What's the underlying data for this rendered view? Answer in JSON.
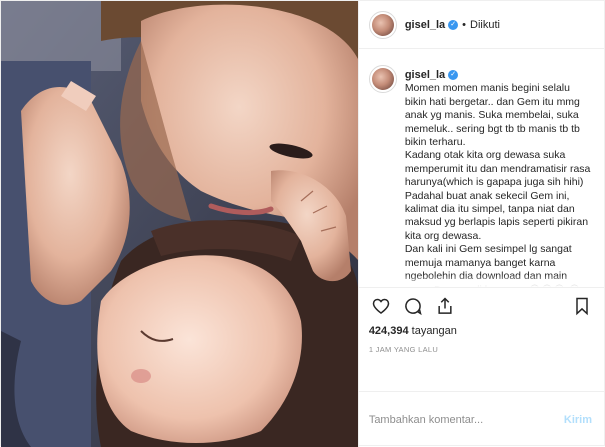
{
  "post": {
    "username": "gisel_la",
    "verified": true,
    "follow_separator": "•",
    "follow_state": "Diikuti",
    "caption_user": "gisel_la",
    "caption_text": "Momen momen manis begini selalu bikin hati bergetar.. dan Gem itu mmg anak yg manis. Suka membelai, suka memeluk.. sering bgt tb tb manis tb tb bikin terharu.\nKadang otak kita org dewasa suka memperumit itu dan mendramatisir rasa harunya(which is gapapa juga sih hihi)\nPadahal buat anak sekecil Gem ini, kalimat dia itu simpel, tanpa niat dan maksud yg berlapis lapis seperti pikiran kita org dewasa.\nDan kali ini Gem sesimpel lg sangat memuja mamanya banget karna ngebolehin dia download dan main game Duggee di hp mama😂😂😂 😂😂😂\nGapapa Gem walau motifnya ada game Duggee ak ttp merinding kok",
    "icons": {
      "like": "heart-icon",
      "comment": "comment-icon",
      "share": "share-icon",
      "save": "bookmark-icon",
      "verified": "verified-badge-icon"
    },
    "views_count": "424,394",
    "views_label": "tayangan",
    "timestamp": "1 JAM YANG LALU",
    "comment_placeholder": "Tambahkan komentar...",
    "post_button": "Kirim"
  },
  "colors": {
    "accent": "#3897f0",
    "post_button_disabled": "#b2dffc",
    "muted": "#8e8e8e",
    "border": "#efefef"
  }
}
